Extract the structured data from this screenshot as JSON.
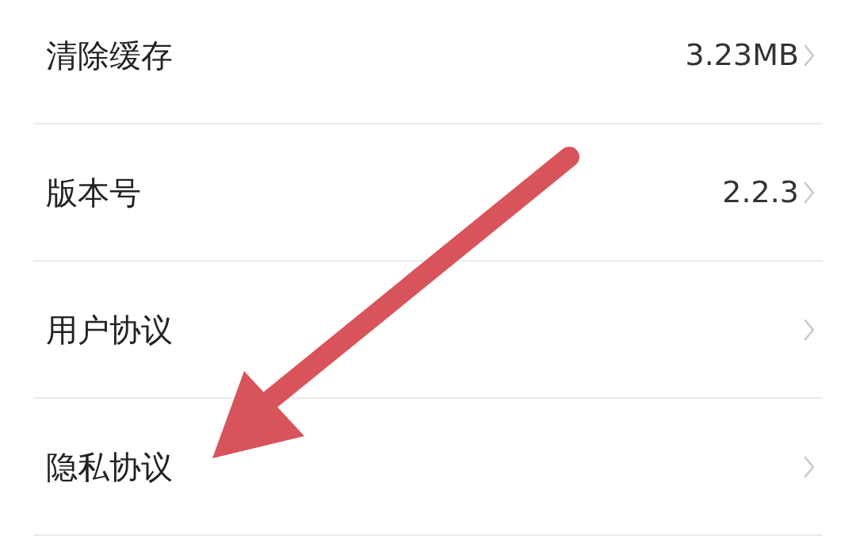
{
  "settings_list": [
    {
      "label": "清除缓存",
      "value": "3.23MB"
    },
    {
      "label": "版本号",
      "value": "2.2.3"
    },
    {
      "label": "用户协议"
    },
    {
      "label": "隐私协议"
    }
  ]
}
